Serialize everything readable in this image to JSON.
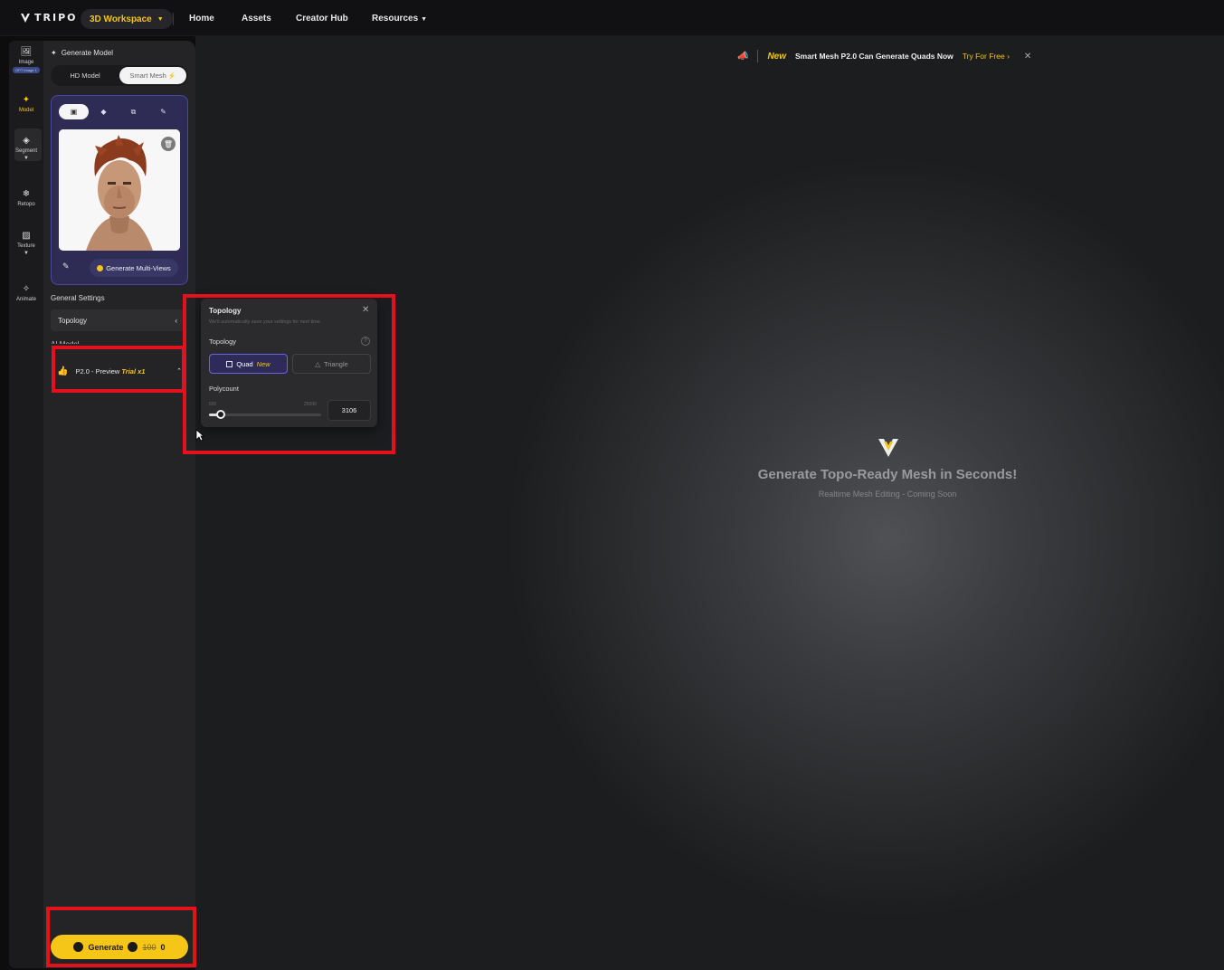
{
  "header": {
    "brand": "TRIPO",
    "workspace_label": "3D Workspace",
    "nav": [
      "Home",
      "Assets",
      "Creator Hub",
      "Resources"
    ]
  },
  "rail": {
    "items": [
      {
        "label": "Image",
        "badge": "GPT Image 1",
        "icon": "image-icon"
      },
      {
        "label": "Model",
        "icon": "sparkle-icon",
        "active": true
      },
      {
        "label": "Segment",
        "icon": "cube-icon"
      },
      {
        "label": "Retopo",
        "icon": "gear-icon"
      },
      {
        "label": "Texture",
        "icon": "texture-icon"
      },
      {
        "label": "Animate",
        "icon": "figure-icon"
      }
    ]
  },
  "panel": {
    "title": "Generate Model",
    "toggle": {
      "hd": "HD Model",
      "smart": "Smart Mesh"
    },
    "multiview_label": "Generate Multi-Views",
    "general_settings": "General Settings",
    "topology_row": "Topology",
    "model_label": "AI Model",
    "model_name": "P2.0 - Preview",
    "model_trial": "Trial x1",
    "generate_label": "Generate",
    "generate_cost_old": "100",
    "generate_cost_new": "0"
  },
  "popup": {
    "title": "Topology",
    "subtitle": "We'll automatically save your settings for next time",
    "topology_label": "Topology",
    "quad_label": "Quad",
    "quad_tag": "New",
    "triangle_label": "Triangle",
    "polycount_label": "Polycount",
    "polycount_min": "500",
    "polycount_max": "25000",
    "polycount_value": "3106",
    "polycount_fraction": 0.106
  },
  "banner": {
    "tag": "New",
    "message": "Smart Mesh P2.0 Can Generate Quads Now",
    "cta": "Try For Free"
  },
  "hero": {
    "title": "Generate Topo-Ready Mesh in Seconds!",
    "subtitle": "Realtime Mesh Editing - Coming Soon"
  },
  "colors": {
    "accent": "#f5c518",
    "highlight": "#e3121a",
    "card": "#2e2c55"
  }
}
